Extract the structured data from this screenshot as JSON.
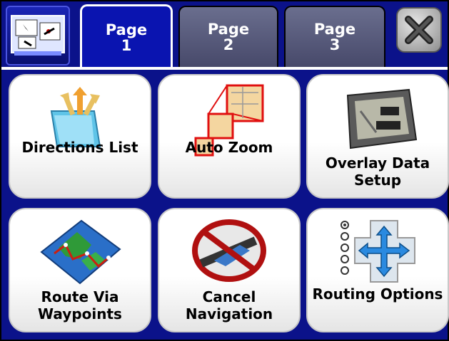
{
  "tabs": [
    {
      "label": "Page\n1",
      "active": true
    },
    {
      "label": "Page\n2",
      "active": false
    },
    {
      "label": "Page\n3",
      "active": false
    }
  ],
  "tiles": [
    {
      "label": "Directions List",
      "icon": "folder-icon"
    },
    {
      "label": "Auto Zoom",
      "icon": "map-zoom-icon"
    },
    {
      "label": "Overlay Data\nSetup",
      "icon": "gps-device-icon"
    },
    {
      "label": "Route Via\nWaypoints",
      "icon": "waypoint-map-icon"
    },
    {
      "label": "Cancel\nNavigation",
      "icon": "cancel-navigation-icon"
    },
    {
      "label": "Routing Options",
      "icon": "routing-options-icon"
    }
  ],
  "colors": {
    "background": "#0b128a",
    "active_tab": "#0a14b0",
    "inactive_tab": "#5a5d7e",
    "tile": "#ffffff"
  }
}
